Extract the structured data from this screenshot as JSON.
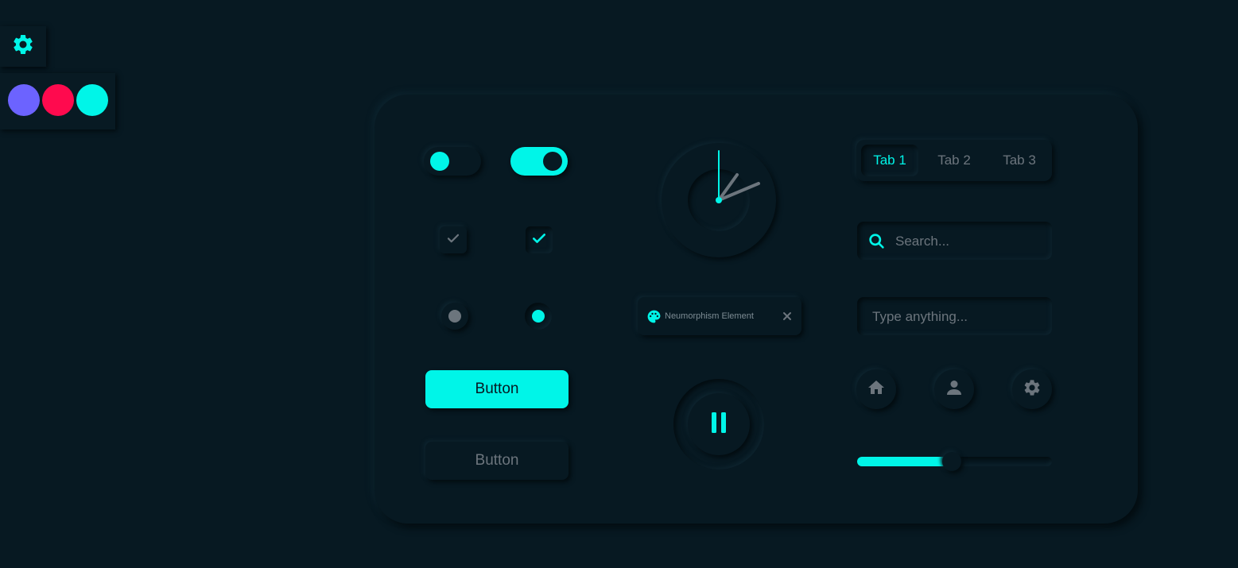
{
  "theme": {
    "accent": "#00f5e8",
    "background": "#071922",
    "muted": "#6c757d"
  },
  "settings": {
    "toggle_icon": "gear-icon",
    "swatches": [
      {
        "name": "purple",
        "color": "#6c63ff"
      },
      {
        "name": "red",
        "color": "#ff0a4e"
      },
      {
        "name": "cyan",
        "color": "#00f5e8"
      }
    ]
  },
  "controls": {
    "switches": [
      {
        "state": "off"
      },
      {
        "state": "on"
      }
    ],
    "checkboxes": [
      {
        "checked": false
      },
      {
        "checked": true
      }
    ],
    "radios": [
      {
        "selected": false
      },
      {
        "selected": true
      }
    ],
    "buttons": {
      "primary_label": "Button",
      "secondary_label": "Button"
    }
  },
  "clock": {
    "hour": 2,
    "minute": 0
  },
  "chip": {
    "icon": "palette-icon",
    "label": "Neumorphism Element",
    "close_icon": "close-icon"
  },
  "player": {
    "state": "playing",
    "icon": "pause-icon"
  },
  "tabs": {
    "items": [
      {
        "label": "Tab 1",
        "active": true
      },
      {
        "label": "Tab 2",
        "active": false
      },
      {
        "label": "Tab 3",
        "active": false
      }
    ]
  },
  "search": {
    "placeholder": "Search...",
    "icon": "search-icon"
  },
  "text_input": {
    "placeholder": "Type anything..."
  },
  "icon_buttons": [
    {
      "icon": "home-icon"
    },
    {
      "icon": "user-icon"
    },
    {
      "icon": "gear-icon"
    }
  ],
  "slider": {
    "value": 0.5
  }
}
